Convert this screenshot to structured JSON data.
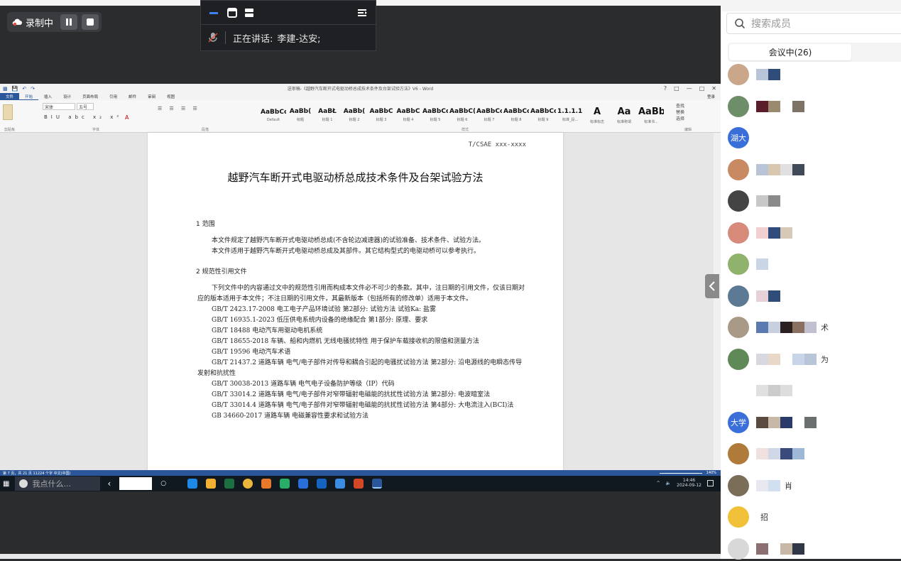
{
  "meeting": {
    "recording_label": "录制中",
    "speaking_prefix": "正在讲话:",
    "speaking_name": "李建-达安;"
  },
  "word": {
    "title": "送审稿-《越野汽车断开式电驱动桥总成技术条件及台架试验方法》V6 - Word",
    "tabs": [
      "文件",
      "开始",
      "插入",
      "设计",
      "页面布局",
      "引用",
      "邮件",
      "审阅",
      "视图"
    ],
    "login": "登录",
    "font_name": "宋体",
    "font_size": "五号",
    "styles": [
      {
        "preview": "AaBbCcDı",
        "name": "Default"
      },
      {
        "preview": "AaBb(",
        "name": "标题"
      },
      {
        "preview": "AaBŁ",
        "name": "标题 1"
      },
      {
        "preview": "AaBb(",
        "name": "标题 2"
      },
      {
        "preview": "AaBbC",
        "name": "标题 3"
      },
      {
        "preview": "AaBbC",
        "name": "标题 4"
      },
      {
        "preview": "AaBbCc",
        "name": "标题 5"
      },
      {
        "preview": "AaBbC(",
        "name": "标题 6"
      },
      {
        "preview": "AaBbCcD",
        "name": "标题 7"
      },
      {
        "preview": "AaBbCc",
        "name": "标题 8"
      },
      {
        "preview": "AaBbCcC",
        "name": "标题 9"
      },
      {
        "preview": "1.1.1.1.",
        "name": "标准_段..."
      },
      {
        "preview": "A",
        "name": "标准标志"
      },
      {
        "preview": "Aa",
        "name": "标准称谓"
      },
      {
        "preview": "AaBbCcDd",
        "name": "标准书..."
      }
    ],
    "group_names": [
      "剪贴板",
      "字体",
      "段落",
      "样式",
      "编辑"
    ],
    "editing": [
      "查找",
      "替换",
      "选择"
    ],
    "doc": {
      "header_code": "T/CSAE xxx-xxxx",
      "title": "越野汽车断开式电驱动桥总成技术条件及台架试验方法",
      "section1": "1  范围",
      "p1": "本文件规定了越野汽车断开式电驱动桥总成(不含轮边减速器)的试验准备、技术条件、试验方法。",
      "p2": "本文件适用于越野汽车断开式电驱动桥总成及其部件。其它结构型式的电驱动桥可以参考执行。",
      "section2": "2  规范性引用文件",
      "p3": "下列文件中的内容通过文中的规范性引用而构成本文件必不可少的条款。其中，注日期的引用文件，仅该日期对应的版本适用于本文件；不注日期的引用文件，其最新版本（包括所有的修改单）适用于本文件。",
      "refs": [
        "GB/T 2423.17-2008 电工电子产品环境试验 第2部分: 试验方法 试验Ka: 盐雾",
        "GB/T 16935.1-2023 低压供电系统内设备的绝缘配合 第1部分: 原理、要求",
        "GB/T 18488 电动汽车用驱动电机系统",
        "GB/T 18655-2018 车辆、船和内燃机 无线电骚扰特性 用于保护车载接收机的限值和测量方法",
        "GB/T 19596 电动汽车术语",
        "GB/T 21437.2 道路车辆 电气/电子部件对传导和耦合引起的电骚扰试验方法 第2部分: 沿电源线的电瞬态传导发射和抗扰性",
        "GB/T 30038-2013 道路车辆 电气电子设备防护等级（IP）代码",
        "GB/T 33014.2 道路车辆 电气/电子部件对窄带辐射电磁能的抗扰性试验方法 第2部分: 电波暗室法",
        "GB/T 33014.4 道路车辆 电气/电子部件对窄带辐射电磁能的抗扰性试验方法 第4部分: 大电流注入(BCI)法",
        "GB 34660-2017 道路车辆 电磁兼容性要求和试验方法"
      ]
    },
    "status": "第 7 页，共 21 页   11224 个字   中文(中国)",
    "zoom": "140%"
  },
  "taskbar": {
    "search_placeholder": "我点什么...",
    "time": "14:46",
    "date": "2024-09-12"
  },
  "panel": {
    "search_placeholder": "搜索成员",
    "tab_label": "会议中(26)",
    "members": [
      {
        "avatar_text": "",
        "avatar_color": "#caa78a",
        "text": ""
      },
      {
        "avatar_text": "",
        "avatar_color": "#6c8f6a",
        "text": ""
      },
      {
        "avatar_text": "湖大",
        "avatar_color": "#3a6ed8",
        "text": ""
      },
      {
        "avatar_text": "",
        "avatar_color": "#c98a63",
        "text": ""
      },
      {
        "avatar_text": "",
        "avatar_color": "#444",
        "text": ""
      },
      {
        "avatar_text": "",
        "avatar_color": "#d88a7a",
        "text": ""
      },
      {
        "avatar_text": "",
        "avatar_color": "#8fb36d",
        "text": ""
      },
      {
        "avatar_text": "",
        "avatar_color": "#5c7a94",
        "text": ""
      },
      {
        "avatar_text": "",
        "avatar_color": "#a89a86",
        "text": "术"
      },
      {
        "avatar_text": "",
        "avatar_color": "#5f8a58",
        "text": "为"
      },
      {
        "avatar_text": "",
        "avatar_color": "#ffffff",
        "text": ""
      },
      {
        "avatar_text": "大学",
        "avatar_color": "#3a6ed8",
        "text": ""
      },
      {
        "avatar_text": "",
        "avatar_color": "#b07a3a",
        "text": ""
      },
      {
        "avatar_text": "",
        "avatar_color": "#7a6e58",
        "text": "肖"
      },
      {
        "avatar_text": "",
        "avatar_color": "#f2c13a",
        "text": "招"
      },
      {
        "avatar_text": "",
        "avatar_color": "#d8d8d8",
        "text": ""
      }
    ]
  }
}
